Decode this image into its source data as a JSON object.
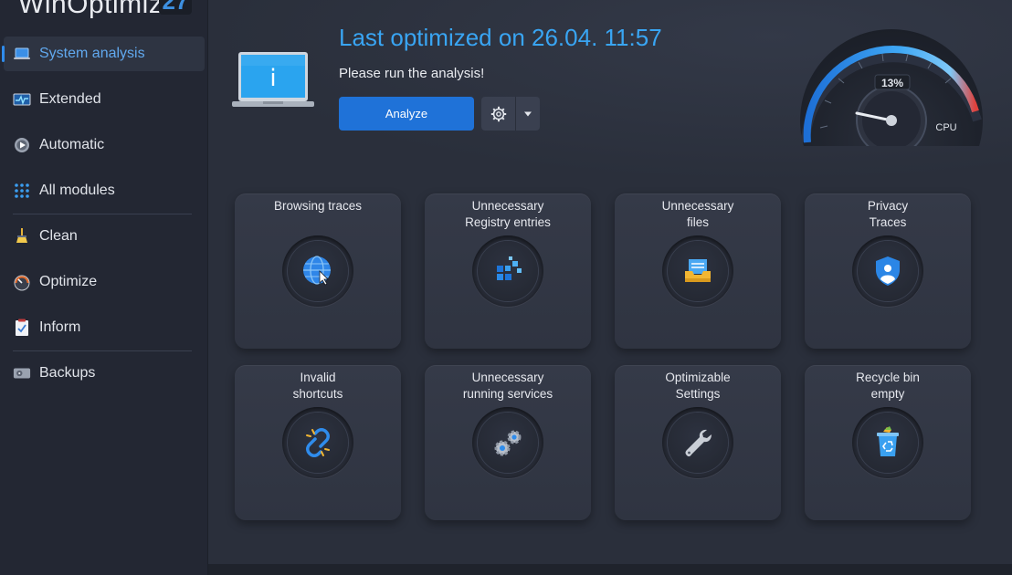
{
  "app": {
    "title": "WinOptimizer",
    "version": "27"
  },
  "sidebar": {
    "items": [
      {
        "label": "System analysis",
        "icon": "laptop-icon",
        "active": true
      },
      {
        "label": "Extended",
        "icon": "pulse-monitor-icon"
      },
      {
        "label": "Automatic",
        "icon": "play-gear-icon"
      },
      {
        "label": "All modules",
        "icon": "grid-dots-icon"
      },
      {
        "label": "Clean",
        "icon": "broom-icon"
      },
      {
        "label": "Optimize",
        "icon": "speedometer-icon"
      },
      {
        "label": "Inform",
        "icon": "clipboard-icon"
      },
      {
        "label": "Backups",
        "icon": "backup-drive-icon"
      }
    ]
  },
  "header": {
    "status_title": "Last optimized on 26.04. 11:57",
    "status_sub": "Please run the analysis!",
    "analyze_label": "Analyze"
  },
  "gauge": {
    "value_text": "13%",
    "label": "CPU",
    "value": 13
  },
  "tiles": [
    {
      "label": "Browsing traces",
      "icon": "globe-cursor-icon"
    },
    {
      "label": "Unnecessary\nRegistry entries",
      "icon": "registry-blocks-icon"
    },
    {
      "label": "Unnecessary\nfiles",
      "icon": "file-tray-icon"
    },
    {
      "label": "Privacy\nTraces",
      "icon": "shield-user-icon"
    },
    {
      "label": "Invalid\nshortcuts",
      "icon": "broken-link-icon"
    },
    {
      "label": "Unnecessary\nrunning services",
      "icon": "gears-icon"
    },
    {
      "label": "Optimizable\nSettings",
      "icon": "wrench-icon"
    },
    {
      "label": "Recycle bin\nempty",
      "icon": "recycle-bin-icon"
    }
  ],
  "colors": {
    "accent": "#39a5f3",
    "button": "#1f72d8"
  }
}
